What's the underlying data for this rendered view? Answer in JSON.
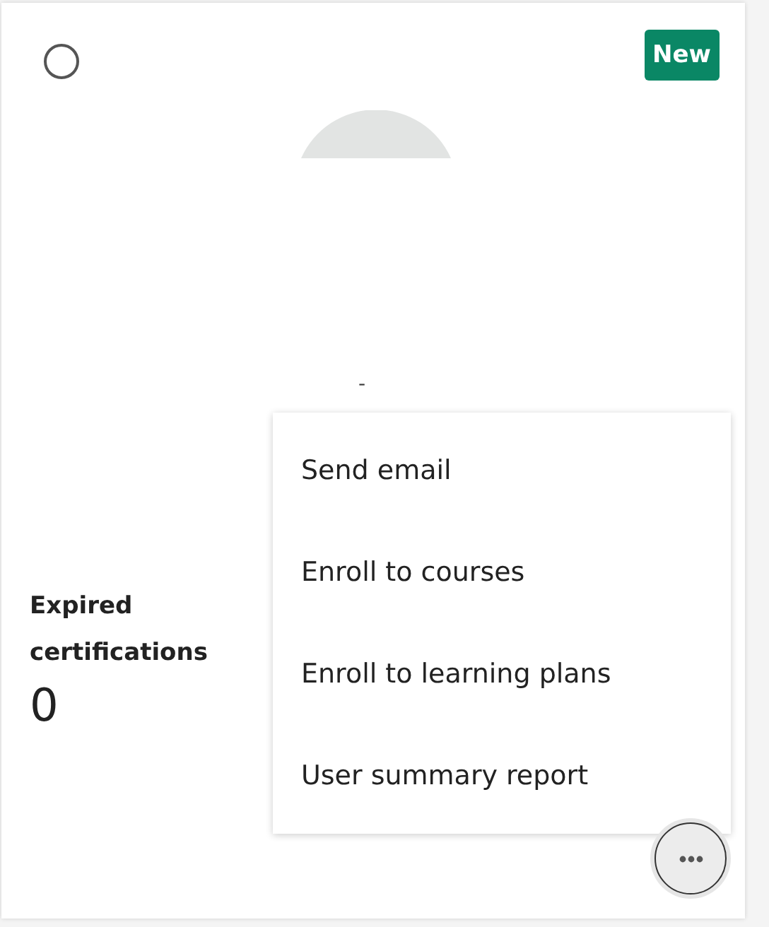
{
  "card": {
    "selected": false,
    "badge": "New",
    "name": "-",
    "stat": {
      "label": "Expired certifications",
      "value": "0"
    },
    "more_menu": {
      "expanded": true,
      "items": [
        {
          "label": "Send email"
        },
        {
          "label": "Enroll to courses"
        },
        {
          "label": "Enroll to learning plans"
        },
        {
          "label": "User summary report"
        }
      ]
    }
  }
}
